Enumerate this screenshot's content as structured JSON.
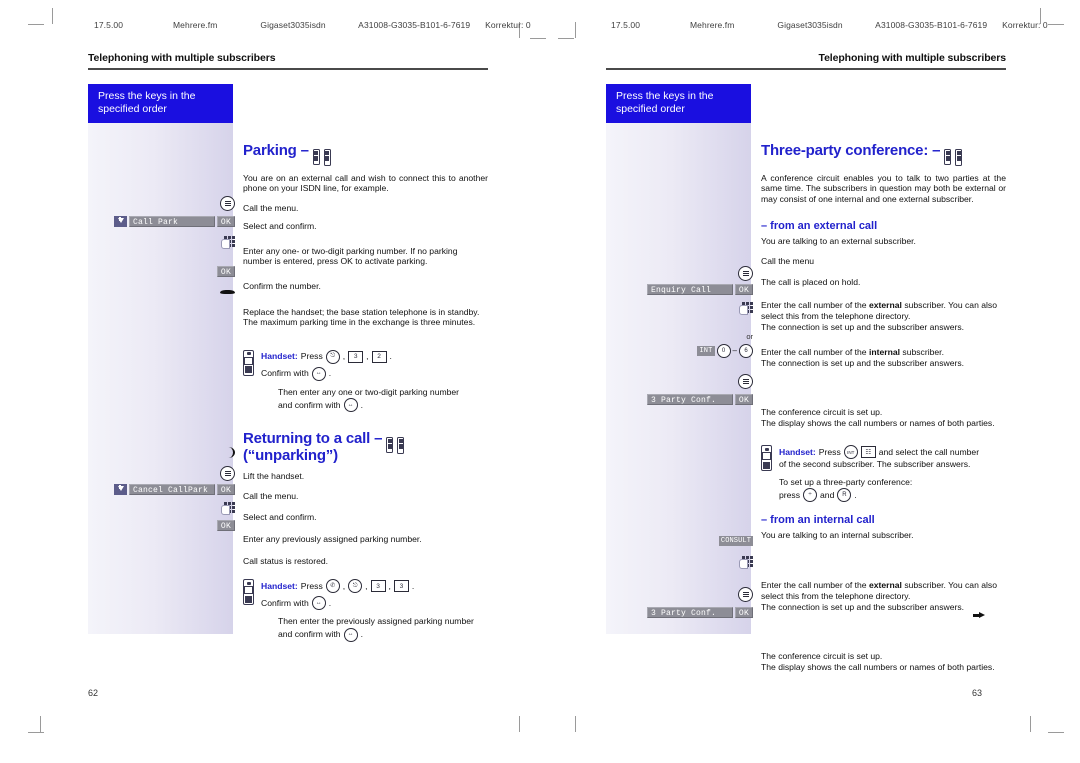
{
  "slug": {
    "left": {
      "version": "17.5.00",
      "file": "Mehrere.fm",
      "product": "Gigaset3035isdn",
      "docnum": "A31008-G3035-B101-6-7619",
      "revision": "Korrektur: 0"
    },
    "right": {
      "version": "17.5.00",
      "file": "Mehrere.fm",
      "product": "Gigaset3035isdn",
      "docnum": "A31008-G3035-B101-6-7619",
      "revision": "Korrektur: 0"
    }
  },
  "left_page": {
    "running_head": "Telephoning with multiple subscribers",
    "page_number": "62",
    "margin_banner": {
      "line1": "Press the keys in the",
      "line2": "specified order"
    },
    "sections": [
      {
        "title": "Parking",
        "dash": "–",
        "intro": "You are on an external call and wish to connect this to another phone on your ISDN line, for example.",
        "steps": [
          {
            "icon": "menu-icon",
            "text": "Call the menu."
          },
          {
            "icon": "display-ok",
            "display": "Call Park",
            "ok": "OK",
            "text": "Select and confirm."
          },
          {
            "icon": "keypad-icon",
            "text": "Enter any one- or two-digit parking number. If no parking number is entered, press OK to activate parking."
          },
          {
            "icon": "ok-key",
            "ok": "OK",
            "text": "Confirm the number."
          },
          {
            "icon": "hangup-icon",
            "text": "Replace the handset; the base station telephone is in standby.\nThe maximum parking time in the exchange is three minutes."
          }
        ],
        "note": {
          "label": "Handset:",
          "press_word": "Press",
          "keys": [
            {
              "shape": "round",
              "label": "⎋"
            },
            {
              "shape": "square",
              "label": "3"
            },
            {
              "shape": "square",
              "label": "2"
            }
          ],
          "confirm_text": "Confirm with",
          "confirm_key": "↔",
          "follow_line1": "Then enter any one or two-digit parking number",
          "follow_line2": "and confirm with",
          "follow_key": "↔"
        }
      },
      {
        "title": "Returning to a call\n(“unparking”)",
        "dash": "–",
        "intro": "",
        "steps": [
          {
            "icon": "lift-handset-icon",
            "text": "Lift the handset."
          },
          {
            "icon": "menu-icon",
            "text": "Call the menu."
          },
          {
            "icon": "display-ok",
            "display": "Cancel CallPark",
            "ok": "OK",
            "text": "Select and confirm."
          },
          {
            "icon": "keypad-icon",
            "text": "Enter any previously assigned parking number."
          },
          {
            "icon": "ok-key",
            "ok": "OK",
            "text": "Call status is restored."
          }
        ],
        "note": {
          "label": "Handset:",
          "press_word": "Press",
          "keys": [
            {
              "shape": "round",
              "label": "✆"
            },
            {
              "shape": "round",
              "label": "⎋"
            },
            {
              "shape": "square",
              "label": "3"
            },
            {
              "shape": "square",
              "label": "3"
            }
          ],
          "confirm_text": "Confirm with",
          "confirm_key": "↔",
          "follow_line1": "Then enter the previously assigned parking number",
          "follow_line2": "and confirm with",
          "follow_key": "↔"
        }
      }
    ]
  },
  "right_page": {
    "running_head": "Telephoning with multiple subscribers",
    "page_number": "63",
    "margin_banner": {
      "line1": "Press the keys in the",
      "line2": "specified order"
    },
    "section": {
      "title": "Three-party conference:",
      "dash": "–",
      "intro": "A conference circuit enables you to talk to two parties at the same time. The subscribers in question may both be external or may consist of one internal and one external subscriber."
    },
    "sub_external": {
      "heading": "– from an external call",
      "lead": "You are talking to an external subscriber.",
      "steps": [
        {
          "icon": "menu-icon",
          "text": "Call the menu"
        },
        {
          "icon": "display-ok",
          "display": "Enquiry Call",
          "ok": "OK",
          "text": "The call is placed on hold."
        },
        {
          "icon": "keypad-icon",
          "text": "Enter the call number of the <b>external</b> subscriber. You can also select this from the telephone directory.\nThe connection is set up and the subscriber answers."
        },
        {
          "icon": "int-range",
          "or": "or",
          "int_label": "INT",
          "key_from": "0",
          "key_to": "6",
          "text": "Enter the call number of the <b>internal</b> subscriber.\nThe connection is set up and the subscriber answers."
        },
        {
          "icon": "menu-icon",
          "text": ""
        },
        {
          "icon": "display-ok",
          "display": "3 Party Conf.",
          "ok": "OK",
          "text": "The conference circuit is set up.\nThe display shows the call numbers or names of both parties."
        }
      ],
      "note": {
        "label": "Handset:",
        "press_word": "Press",
        "keys": [
          {
            "shape": "round",
            "label": "INT"
          },
          {
            "shape": "square",
            "label": "☷"
          }
        ],
        "line1_tail": "and select the call number",
        "line2": "of the second subscriber. The subscriber answers.",
        "follow_line1": "To set up a three-party conference:",
        "follow_line2_pre": "press",
        "follow_key1": "÷",
        "follow_mid": "and",
        "follow_key2": "R",
        "follow_tail": "."
      }
    },
    "sub_internal": {
      "heading": "– from an internal call",
      "lead": "You are talking to an internal subscriber.",
      "steps": [
        {
          "icon": "consult-key",
          "consult": "CONSULT",
          "text": ""
        },
        {
          "icon": "keypad-icon",
          "text": "Enter the call number of the <b>external</b> subscriber. You can also select this from the telephone directory.\nThe connection is set up and the subscriber answers."
        },
        {
          "icon": "menu-icon",
          "text": ""
        },
        {
          "icon": "display-ok",
          "display": "3 Party Conf.",
          "ok": "OK",
          "text": "The conference circuit is set up.\nThe display shows the call numbers or names of both parties."
        }
      ]
    }
  },
  "colors": {
    "heading_blue": "#2222cc",
    "banner_blue": "#1a0fe0",
    "display_gray": "#8d8d96",
    "margin_gradient_end": "#d6d3ea"
  }
}
